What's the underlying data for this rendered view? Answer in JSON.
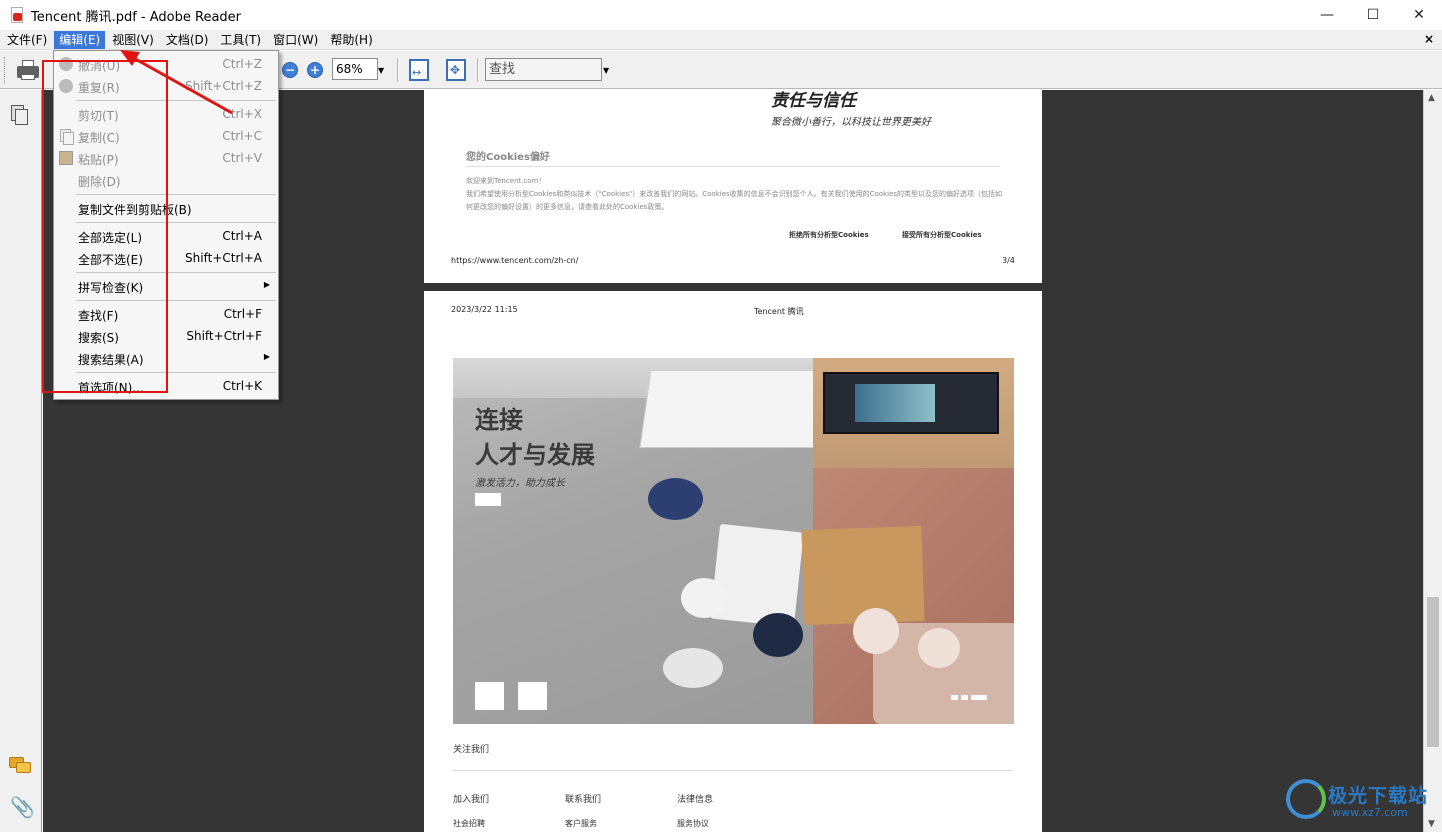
{
  "window": {
    "title": "Tencent 腾讯.pdf - Adobe Reader",
    "controls": {
      "minimize": "—",
      "maximize": "☐",
      "close": "✕"
    }
  },
  "menubar": {
    "items": [
      "文件(F)",
      "编辑(E)",
      "视图(V)",
      "文档(D)",
      "工具(T)",
      "窗口(W)",
      "帮助(H)"
    ],
    "active_index": 1,
    "close_glyph": "×"
  },
  "toolbar": {
    "zoom_value": "68%",
    "zoom_out_glyph": "−",
    "zoom_in_glyph": "+",
    "find_placeholder": "查找",
    "dropdown_glyph": "▼"
  },
  "edit_menu": {
    "items": [
      {
        "label": "撤消(U)",
        "shortcut": "Ctrl+Z",
        "disabled": true
      },
      {
        "label": "重复(R)",
        "shortcut": "Shift+Ctrl+Z",
        "disabled": true
      },
      {
        "label": "剪切(T)",
        "shortcut": "Ctrl+X",
        "disabled": true
      },
      {
        "label": "复制(C)",
        "shortcut": "Ctrl+C",
        "disabled": true
      },
      {
        "label": "粘贴(P)",
        "shortcut": "Ctrl+V",
        "disabled": true
      },
      {
        "label": "删除(D)",
        "shortcut": "",
        "disabled": true
      },
      {
        "label": "复制文件到剪贴板(B)",
        "shortcut": "",
        "disabled": false
      },
      {
        "label": "全部选定(L)",
        "shortcut": "Ctrl+A",
        "disabled": false
      },
      {
        "label": "全部不选(E)",
        "shortcut": "Shift+Ctrl+A",
        "disabled": false
      },
      {
        "label": "拼写检查(K)",
        "shortcut": "",
        "disabled": false,
        "submenu": true
      },
      {
        "label": "查找(F)",
        "shortcut": "Ctrl+F",
        "disabled": false
      },
      {
        "label": "搜索(S)",
        "shortcut": "Shift+Ctrl+F",
        "disabled": false
      },
      {
        "label": "搜索结果(A)",
        "shortcut": "",
        "disabled": false,
        "submenu": true
      },
      {
        "label": "首选项(N)...",
        "shortcut": "Ctrl+K",
        "disabled": false
      }
    ],
    "submenu_glyph": "▶"
  },
  "page1": {
    "heading": "责任与信任",
    "subheading": "聚合微小善行，以科技让世界更美好",
    "cookie_title": "您的Cookies偏好",
    "cookie_welcome": "欢迎来到Tencent.com！",
    "cookie_body": "我们希望使用分析型Cookies和类似技术（\"Cookies\"）来改善我们的网站。Cookies收集的信息不会识别您个人。有关我们使用的Cookies的类型以及您的偏好选项（包括如何更改您的偏好设置）的更多信息，请查看此处的Cookies政策。",
    "reject_label": "拒绝所有分析型Cookies",
    "accept_label": "接受所有分析型Cookies",
    "url": "https://www.tencent.com/zh-cn/",
    "page_number": "3/4"
  },
  "page2": {
    "date": "2023/3/22 11:15",
    "header": "Tencent 腾讯",
    "hero_title_1": "连接",
    "hero_title_2": "人才与发展",
    "hero_tagline": "激发活力，助力成长",
    "follow_us": "关注我们",
    "footer_columns": [
      "加入我们",
      "联系我们",
      "法律信息"
    ],
    "footer_subitems": [
      "社会招聘",
      "客户服务",
      "服务协议"
    ]
  },
  "watermark": {
    "brand": "极光下载站",
    "url": "www.xz7.com"
  },
  "colors": {
    "menu_active": "#3c78d8",
    "annotation_red": "#e11414",
    "doc_background": "#353535"
  }
}
